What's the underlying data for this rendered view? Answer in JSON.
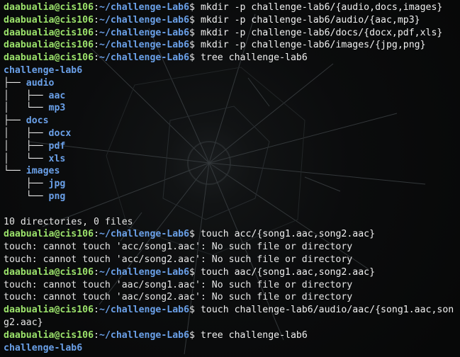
{
  "prompt": {
    "user": "daabualia@cis106",
    "path": "~/challenge-Lab6",
    "symbol": "$"
  },
  "lines": [
    {
      "type": "prompt",
      "cmd": "mkdir -p challenge-lab6/{audio,docs,images}"
    },
    {
      "type": "prompt",
      "cmd": "mkdir -p challenge-lab6/audio/{aac,mp3}"
    },
    {
      "type": "prompt",
      "cmd": "mkdir -p challenge-lab6/docs/{docx,pdf,xls}"
    },
    {
      "type": "prompt",
      "cmd": "mkdir -p challenge-lab6/images/{jpg,png}"
    },
    {
      "type": "prompt",
      "cmd": "tree challenge-lab6"
    },
    {
      "type": "tree",
      "prefix": "",
      "name": "challenge-lab6"
    },
    {
      "type": "tree",
      "prefix": "├── ",
      "name": "audio"
    },
    {
      "type": "tree",
      "prefix": "│   ├── ",
      "name": "aac"
    },
    {
      "type": "tree",
      "prefix": "│   └── ",
      "name": "mp3"
    },
    {
      "type": "tree",
      "prefix": "├── ",
      "name": "docs"
    },
    {
      "type": "tree",
      "prefix": "│   ├── ",
      "name": "docx"
    },
    {
      "type": "tree",
      "prefix": "│   ├── ",
      "name": "pdf"
    },
    {
      "type": "tree",
      "prefix": "│   └── ",
      "name": "xls"
    },
    {
      "type": "tree",
      "prefix": "└── ",
      "name": "images"
    },
    {
      "type": "tree",
      "prefix": "    ├── ",
      "name": "jpg"
    },
    {
      "type": "tree",
      "prefix": "    └── ",
      "name": "png"
    },
    {
      "type": "blank"
    },
    {
      "type": "output",
      "text": "10 directories, 0 files"
    },
    {
      "type": "prompt",
      "cmd": "touch acc/{song1.aac,song2.aac}"
    },
    {
      "type": "output",
      "text": "touch: cannot touch 'acc/song1.aac': No such file or directory"
    },
    {
      "type": "output",
      "text": "touch: cannot touch 'acc/song2.aac': No such file or directory"
    },
    {
      "type": "prompt",
      "cmd": "touch aac/{song1.aac,song2.aac}"
    },
    {
      "type": "output",
      "text": "touch: cannot touch 'aac/song1.aac': No such file or directory"
    },
    {
      "type": "output",
      "text": "touch: cannot touch 'aac/song2.aac': No such file or directory"
    },
    {
      "type": "prompt",
      "cmd": "touch challenge-lab6/audio/aac/{song1.aac,son"
    },
    {
      "type": "output",
      "text": "g2.aac}"
    },
    {
      "type": "prompt",
      "cmd": "tree challenge-lab6"
    },
    {
      "type": "tree",
      "prefix": "",
      "name": "challenge-lab6"
    }
  ]
}
